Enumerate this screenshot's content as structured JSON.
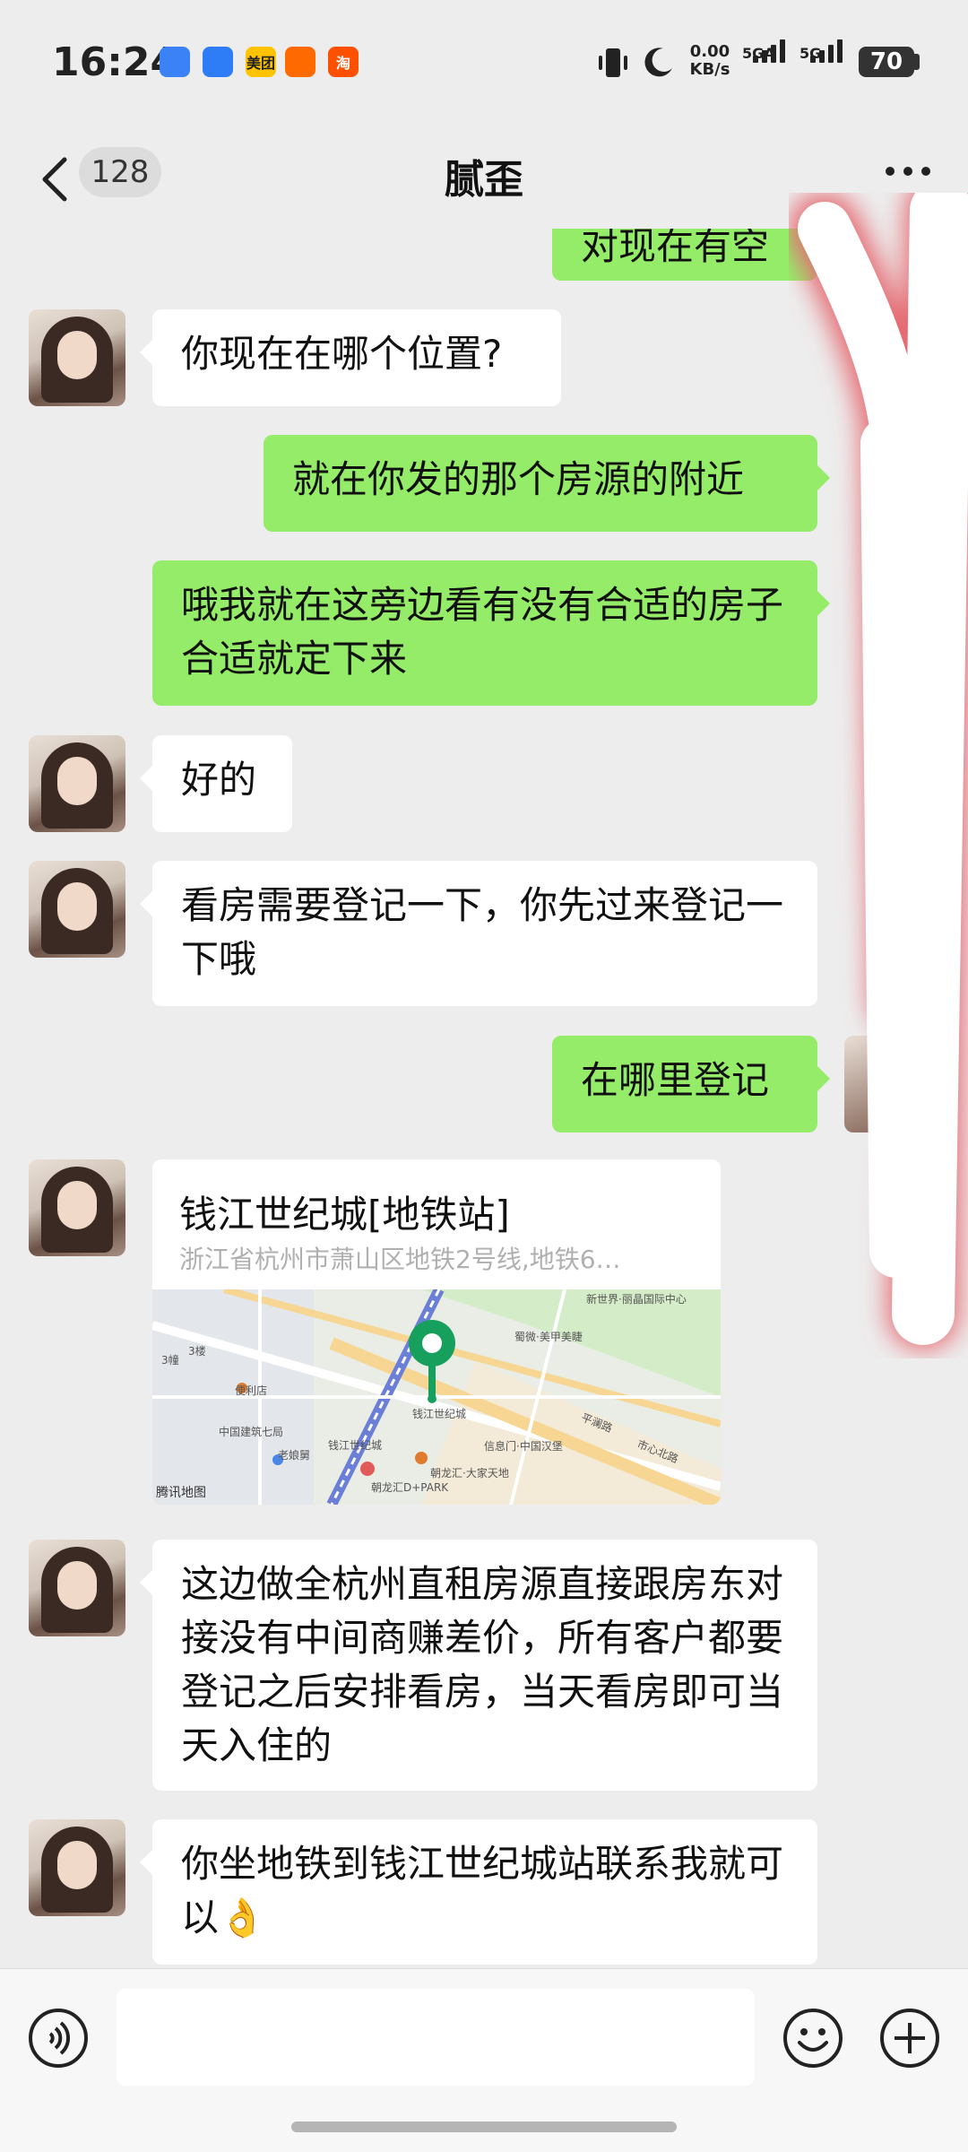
{
  "status_bar": {
    "time": "16:24",
    "apps": [
      "meituan-icon",
      "taobao-icon"
    ],
    "app_labels": [
      "美团",
      "淘"
    ],
    "network_speed_value": "0.00",
    "network_speed_unit": "KB/s",
    "sim1": "5GA",
    "sim2": "5G",
    "battery": "70"
  },
  "header": {
    "unread_count": "128",
    "title": "腻歪"
  },
  "messages": [
    {
      "side": "out",
      "text": "对现在有空"
    },
    {
      "side": "in",
      "text": "你现在在哪个位置?"
    },
    {
      "side": "out",
      "text": "就在你发的那个房源的附近"
    },
    {
      "side": "out",
      "text": "哦我就在这旁边看有没有合适的房子合适就定下来"
    },
    {
      "side": "in",
      "text": "好的"
    },
    {
      "side": "in",
      "text": "看房需要登记一下，你先过来登记一下哦"
    },
    {
      "side": "out",
      "text": "在哪里登记"
    },
    {
      "side": "in",
      "text": "这边做全杭州直租房源直接跟房东对接没有中间商赚差价，所有客户都要登记之后安排看房，当天看房即可当天入住的"
    },
    {
      "side": "in",
      "text": "你坐地铁到钱江世纪城站联系我就可以👌"
    }
  ],
  "location_card": {
    "name": "钱江世纪城[地铁站]",
    "address": "浙江省杭州市萧山区地铁2号线,地铁6…",
    "map_brand": "腾讯地图",
    "map_labels": [
      "新世界·丽晶国际中心",
      "便利店",
      "中国建筑七局",
      "钱江世纪城",
      "老娘舅",
      "钱江世纪城",
      "朝龙汇D+PARK",
      "朝龙汇·大家天地",
      "信息门·中国汉堡",
      "平澜路",
      "市心北路",
      "蜀微·美甲美睫",
      "3幢",
      "3楼"
    ]
  },
  "input_bar": {
    "placeholder": ""
  },
  "colors": {
    "background": "#ededed",
    "outgoing_bubble": "#95ec69",
    "incoming_bubble": "#ffffff",
    "map_pin": "#17a05d"
  }
}
